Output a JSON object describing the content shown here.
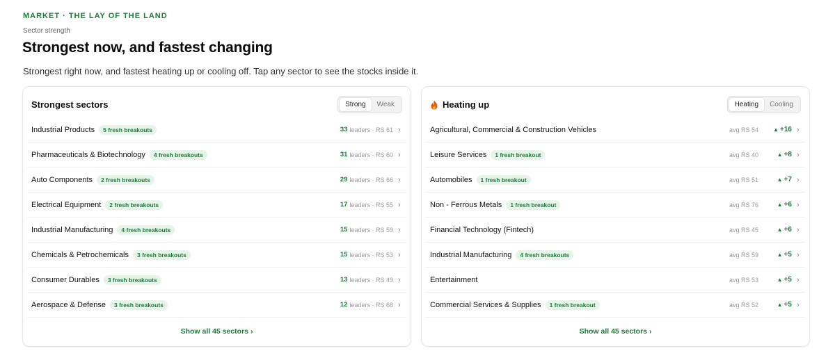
{
  "header": {
    "eyebrow": "MARKET · THE LAY OF THE LAND",
    "kicker": "Sector strength",
    "title": "Strongest now, and fastest changing",
    "subtitle": "Strongest right now, and fastest heating up or cooling off. Tap any sector to see the stocks inside it."
  },
  "strongest": {
    "title": "Strongest sectors",
    "toggle": [
      "Strong",
      "Weak"
    ],
    "active_toggle": "Strong",
    "leaders_word": "leaders",
    "rows": [
      {
        "name": "Industrial Products",
        "badge": "5 fresh breakouts",
        "leaders": "33",
        "rs": "RS 61"
      },
      {
        "name": "Pharmaceuticals & Biotechnology",
        "badge": "4 fresh breakouts",
        "leaders": "31",
        "rs": "RS 60"
      },
      {
        "name": "Auto Components",
        "badge": "2 fresh breakouts",
        "leaders": "29",
        "rs": "RS 66"
      },
      {
        "name": "Electrical Equipment",
        "badge": "2 fresh breakouts",
        "leaders": "17",
        "rs": "RS 55"
      },
      {
        "name": "Industrial Manufacturing",
        "badge": "4 fresh breakouts",
        "leaders": "15",
        "rs": "RS 59"
      },
      {
        "name": "Chemicals & Petrochemicals",
        "badge": "3 fresh breakouts",
        "leaders": "15",
        "rs": "RS 53"
      },
      {
        "name": "Consumer Durables",
        "badge": "3 fresh breakouts",
        "leaders": "13",
        "rs": "RS 49"
      },
      {
        "name": "Aerospace & Defense",
        "badge": "3 fresh breakouts",
        "leaders": "12",
        "rs": "RS 68"
      }
    ],
    "show_all": "Show all 45 sectors ›"
  },
  "heating": {
    "title": "Heating up",
    "icon": "flame-icon",
    "toggle": [
      "Heating",
      "Cooling"
    ],
    "active_toggle": "Heating",
    "rows": [
      {
        "name": "Agricultural, Commercial & Construction Vehicles",
        "badge": "",
        "avg": "avg RS 54",
        "delta": "+16"
      },
      {
        "name": "Leisure Services",
        "badge": "1 fresh breakout",
        "avg": "avg RS 40",
        "delta": "+8"
      },
      {
        "name": "Automobiles",
        "badge": "1 fresh breakout",
        "avg": "avg RS 51",
        "delta": "+7"
      },
      {
        "name": "Non - Ferrous Metals",
        "badge": "1 fresh breakout",
        "avg": "avg RS 76",
        "delta": "+6"
      },
      {
        "name": "Financial Technology (Fintech)",
        "badge": "",
        "avg": "avg RS 45",
        "delta": "+6"
      },
      {
        "name": "Industrial Manufacturing",
        "badge": "4 fresh breakouts",
        "avg": "avg RS 59",
        "delta": "+5"
      },
      {
        "name": "Entertainment",
        "badge": "",
        "avg": "avg RS 53",
        "delta": "+5"
      },
      {
        "name": "Commercial Services & Supplies",
        "badge": "1 fresh breakout",
        "avg": "avg RS 52",
        "delta": "+5"
      }
    ],
    "show_all": "Show all 45 sectors ›"
  },
  "colors": {
    "accent": "#1a7f37",
    "badge_bg": "#e6f4ea",
    "flame": "#e8590c"
  }
}
